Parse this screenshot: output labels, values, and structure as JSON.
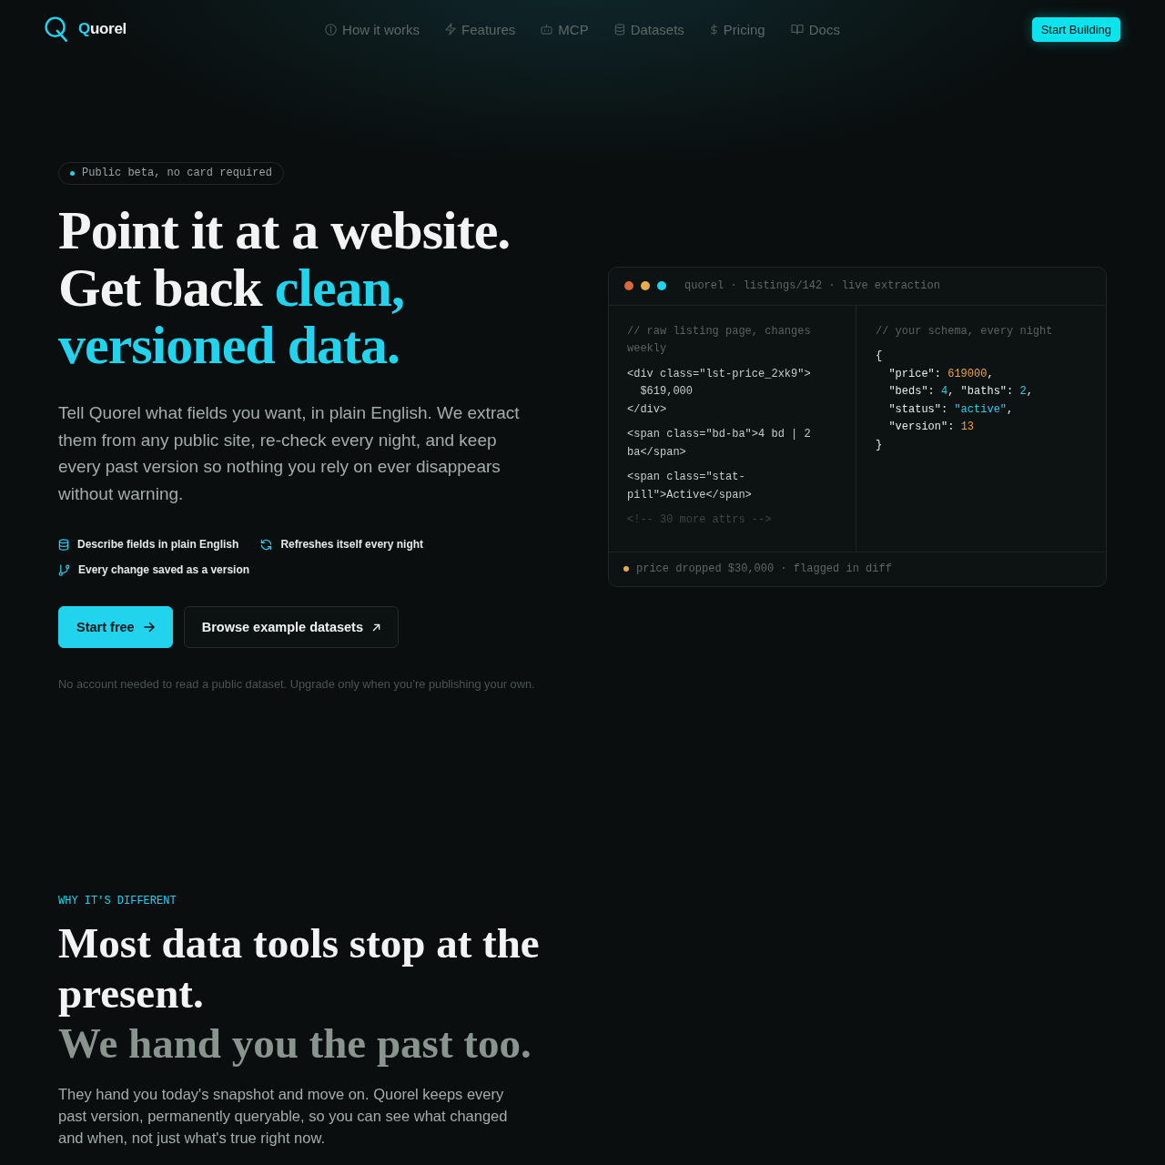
{
  "nav": {
    "brand": "Quorel",
    "links": [
      {
        "label": "How it works"
      },
      {
        "label": "Features"
      },
      {
        "label": "MCP"
      },
      {
        "label": "Datasets"
      },
      {
        "label": "Pricing"
      },
      {
        "label": "Docs"
      }
    ],
    "cta": "Start Building"
  },
  "hero": {
    "badge": "Public beta, no card required",
    "headline": [
      {
        "segments": [
          {
            "text": "Point it at a website.",
            "accent": false
          }
        ]
      },
      {
        "segments": [
          {
            "text": "Get back ",
            "accent": false
          },
          {
            "text": "clean,",
            "accent": true
          }
        ]
      },
      {
        "segments": [
          {
            "text": "versioned data.",
            "accent": true
          }
        ]
      }
    ],
    "lead": "Tell Quorel what fields you want, in plain English. We extract them from any public site, re-check every night, and keep every past version so nothing you rely on ever disappears without warning.",
    "features": [
      {
        "label": "Describe fields in plain English"
      },
      {
        "label": "Refreshes itself every night"
      },
      {
        "label": "Every change saved as a version"
      }
    ],
    "buttons": [
      {
        "label": "Start free",
        "kind": "primary"
      },
      {
        "label": "Browse example datasets",
        "kind": "secondary"
      }
    ],
    "note": "No account needed to read a public dataset. Upgrade only when you’re publishing your own."
  },
  "preview": {
    "window_dots": [
      {
        "color": "#d9673b"
      },
      {
        "color": "#e6ad4a"
      },
      {
        "color": "#22d3ee"
      }
    ],
    "title": "quorel · listings/142 · live extraction",
    "source": {
      "blocks": [
        {
          "kind": "comment",
          "lines": [
            "// raw listing page, changes weekly"
          ]
        },
        {
          "kind": "code",
          "lines": [
            "<div class=\"lst-price_2xk9\">",
            "  $619,000",
            "</div>"
          ]
        },
        {
          "kind": "code",
          "lines": [
            "<span class=\"bd-ba\">4 bd | 2 ba</span>"
          ]
        },
        {
          "kind": "code",
          "lines": [
            "<span class=\"stat-pill\">Active</span>"
          ]
        },
        {
          "kind": "muted",
          "lines": [
            "<!-- 30 more attrs -->"
          ]
        }
      ]
    },
    "output": {
      "comment": "// your schema, every night",
      "lines": [
        {
          "tokens": [
            {
              "text": "{",
              "kind": "plain"
            }
          ]
        },
        {
          "tokens": [
            {
              "text": "  \"price\": ",
              "kind": "plain"
            },
            {
              "text": "619000",
              "kind": "warm"
            },
            {
              "text": ",",
              "kind": "plain"
            }
          ]
        },
        {
          "tokens": [
            {
              "text": "  \"beds\": ",
              "kind": "plain"
            },
            {
              "text": "4",
              "kind": "cool"
            },
            {
              "text": ", \"baths\": ",
              "kind": "plain"
            },
            {
              "text": "2",
              "kind": "cool"
            },
            {
              "text": ",",
              "kind": "plain"
            }
          ]
        },
        {
          "tokens": [
            {
              "text": "  \"status\": ",
              "kind": "plain"
            },
            {
              "text": "\"active\"",
              "kind": "cool"
            },
            {
              "text": ",",
              "kind": "plain"
            }
          ]
        },
        {
          "tokens": [
            {
              "text": "  \"version\": ",
              "kind": "plain"
            },
            {
              "text": "13",
              "kind": "warm"
            }
          ]
        },
        {
          "tokens": [
            {
              "text": "}",
              "kind": "plain"
            }
          ]
        }
      ]
    },
    "footer": "price dropped $30,000 · flagged in diff"
  },
  "why": {
    "eyebrow": "WHY IT'S DIFFERENT",
    "headline": [
      {
        "text": "Most data tools stop at the present.",
        "muted": false
      },
      {
        "text": "We hand you the past too.",
        "muted": true
      }
    ],
    "body": "They hand you today's snapshot and move on. Quorel keeps every past version, permanently queryable, so you can see what changed and when, not just what's true right now."
  }
}
